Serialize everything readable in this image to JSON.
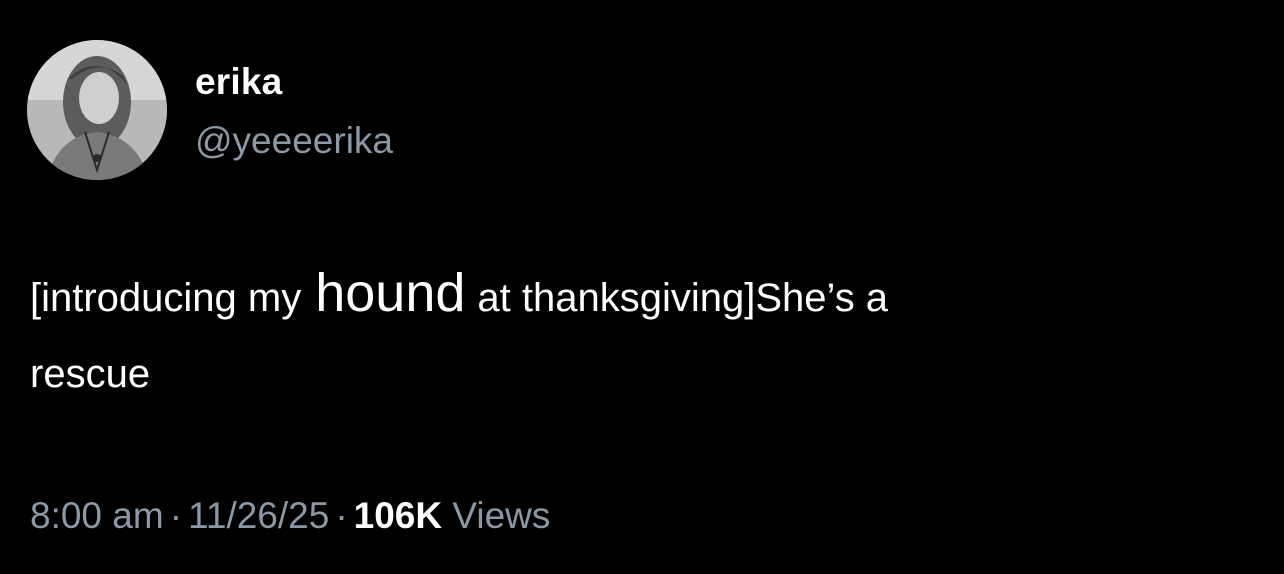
{
  "user": {
    "display_name": "erika",
    "handle": "@yeeeerika",
    "avatar_icon": "profile-photo"
  },
  "tweet": {
    "segment1": "[introducing my",
    "segment2": "hound",
    "segment3": "at thanksgiving]",
    "segment4": "She’s a",
    "line2": "rescue"
  },
  "meta": {
    "time": "8:00 am",
    "separator": "·",
    "date": "11/26/25",
    "views_count": "106K",
    "views_label": "Views"
  },
  "colors": {
    "background": "#000000",
    "text": "#ffffff",
    "muted": "#8b98a5"
  }
}
